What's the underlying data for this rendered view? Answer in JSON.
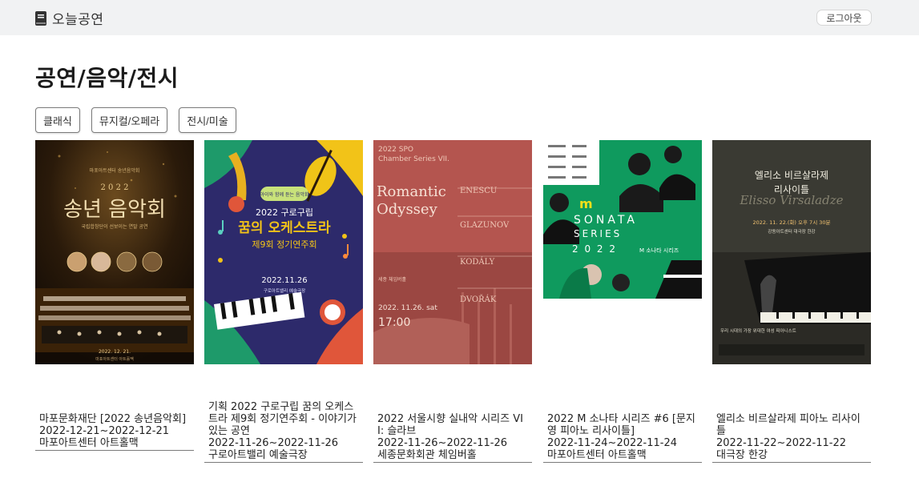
{
  "brand": {
    "name": "오늘공연",
    "icon": "book-icon"
  },
  "header": {
    "logout_label": "로그아웃"
  },
  "page": {
    "title": "공연/음악/전시"
  },
  "filters": [
    {
      "label": "클래식"
    },
    {
      "label": "뮤지컬/오페라"
    },
    {
      "label": "전시/미술"
    }
  ],
  "posters": {
    "p1": {
      "small": "마포아트센터 송년음악회",
      "year": "2 0 2 2",
      "title": "송년 음악회",
      "sub": "국립합창단이 선보이는 연말 공연",
      "date": "2022. 12. 21.",
      "place": "마포아트센터 아트홀맥"
    },
    "p2": {
      "tag": "아이와 함께 듣는 음악회",
      "line1": "2022 구로구립",
      "title": "꿈의 오케스트라",
      "line3": "제9회 정기연주회",
      "date": "2022.11.26",
      "place": "구로아트밸리 예술극장"
    },
    "p3": {
      "series": "2022 SPO",
      "series2": "Chamber Series VII.",
      "title1": "Romantic",
      "title2": "Odyssey",
      "c1": "ENESCU",
      "c2": "GLAZUNOV",
      "c3": "KODÁLY",
      "c4": "DVOŘÁK",
      "hall": "세종 체임버홀",
      "date": "2022. 11.26. sat",
      "time": "17:00"
    },
    "p4": {
      "m": "m",
      "title": "SONATA",
      "series": "SERIES",
      "year": "2 0 2 2",
      "label": "M 소나타 시리즈"
    },
    "p5": {
      "title1": "엘리소 비르살라제",
      "title2": "리사이틀",
      "script": "Elisso Virsaladze",
      "date": "2022. 11. 22.(화) 오후 7시 30분",
      "place": "강동아트센터 대극장 한강",
      "quote": "우리 시대의 가장 위대한 여성 피아니스트"
    }
  },
  "cards": [
    {
      "title": "마포문화재단 [2022 송년음악회]",
      "dates": "2022-12-21~2022-12-21",
      "venue": "마포아트센터 아트홀맥"
    },
    {
      "title": "기획 2022 구로구립 꿈의 오케스트라 제9회 정기연주회 - 이야기가 있는 공연",
      "dates": "2022-11-26~2022-11-26",
      "venue": "구로아트밸리 예술극장"
    },
    {
      "title": "2022 서울시향 실내악 시리즈 VII: 슬라브",
      "dates": "2022-11-26~2022-11-26",
      "venue": "세종문화회관 체임버홀"
    },
    {
      "title": "2022 M 소나타 시리즈 #6 [문지영 피아노 리사이틀]",
      "dates": "2022-11-24~2022-11-24",
      "venue": "마포아트센터 아트홀맥"
    },
    {
      "title": "엘리소 비르살라제 피아노 리사이틀",
      "dates": "2022-11-22~2022-11-22",
      "venue": "대극장 한강"
    }
  ]
}
